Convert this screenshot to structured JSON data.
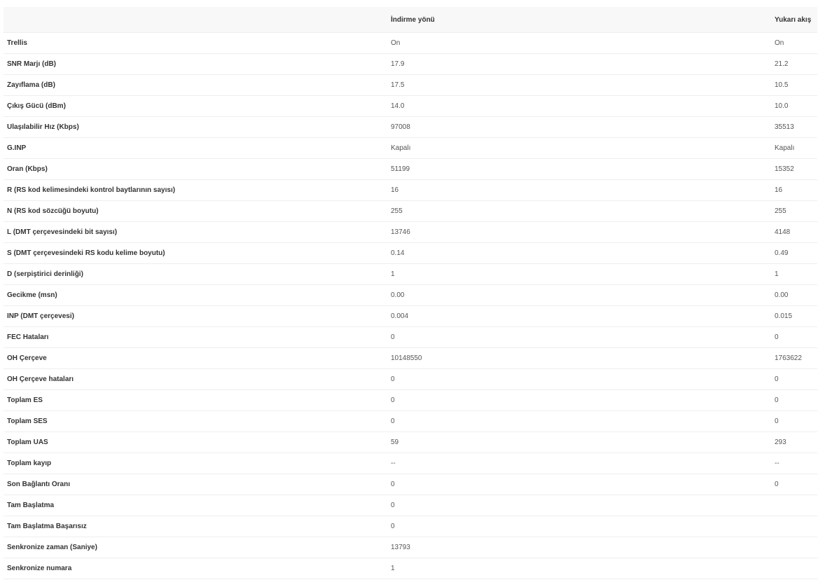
{
  "table": {
    "headers": [
      "",
      "İndirme yönü",
      "Yukarı akış"
    ],
    "rows": [
      {
        "label": "Trellis",
        "down": "On",
        "up": "On"
      },
      {
        "label": "SNR Marjı (dB)",
        "down": "17.9",
        "up": "21.2"
      },
      {
        "label": "Zayıflama (dB)",
        "down": "17.5",
        "up": "10.5"
      },
      {
        "label": "Çıkış Gücü (dBm)",
        "down": "14.0",
        "up": "10.0"
      },
      {
        "label": "Ulaşılabilir Hız (Kbps)",
        "down": "97008",
        "up": "35513"
      },
      {
        "label": "G.INP",
        "down": "Kapalı",
        "up": "Kapalı"
      },
      {
        "label": "Oran (Kbps)",
        "down": "51199",
        "up": "15352"
      },
      {
        "label": "R (RS kod kelimesindeki kontrol baytlarının sayısı)",
        "down": "16",
        "up": "16"
      },
      {
        "label": "N (RS kod sözcüğü boyutu)",
        "down": "255",
        "up": "255"
      },
      {
        "label": "L (DMT çerçevesindeki bit sayısı)",
        "down": "13746",
        "up": "4148"
      },
      {
        "label": "S (DMT çerçevesindeki RS kodu kelime boyutu)",
        "down": "0.14",
        "up": "0.49"
      },
      {
        "label": "D (serpiştirici derinliği)",
        "down": "1",
        "up": "1"
      },
      {
        "label": "Gecikme (msn)",
        "down": "0.00",
        "up": "0.00"
      },
      {
        "label": "INP (DMT çerçevesi)",
        "down": "0.004",
        "up": "0.015"
      },
      {
        "label": "FEC Hataları",
        "down": "0",
        "up": "0"
      },
      {
        "label": "OH Çerçeve",
        "down": "10148550",
        "up": "1763622"
      },
      {
        "label": "OH Çerçeve hataları",
        "down": "0",
        "up": "0"
      },
      {
        "label": "Toplam ES",
        "down": "0",
        "up": "0"
      },
      {
        "label": "Toplam SES",
        "down": "0",
        "up": "0"
      },
      {
        "label": "Toplam UAS",
        "down": "59",
        "up": "293"
      },
      {
        "label": "Toplam kayıp",
        "down": "--",
        "up": "--"
      },
      {
        "label": "Son Bağlantı Oranı",
        "down": "0",
        "up": "0"
      },
      {
        "label": "Tam Başlatma",
        "down": "0",
        "up": ""
      },
      {
        "label": "Tam Başlatma Başarısız",
        "down": "0",
        "up": ""
      },
      {
        "label": "Senkronize zaman (Saniye)",
        "down": "13793",
        "up": ""
      },
      {
        "label": "Senkronize numara",
        "down": "1",
        "up": ""
      }
    ]
  }
}
